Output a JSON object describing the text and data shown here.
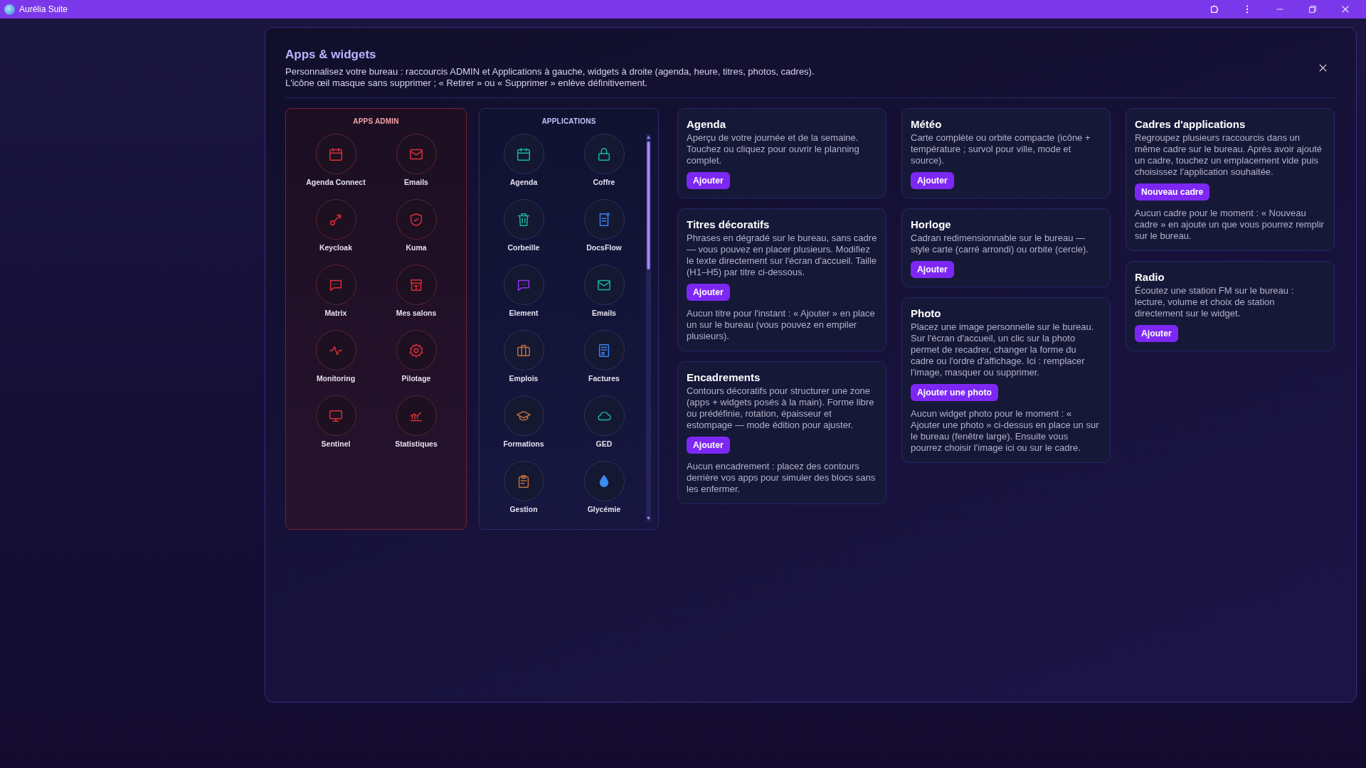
{
  "titlebar": {
    "title": "Aurélia Suite"
  },
  "dialog": {
    "title": "Apps & widgets",
    "description": [
      "Personnalisez votre bureau : raccourcis ADMIN et Applications à gauche, widgets à droite (agenda, heure, titres, photos, cadres).",
      "L'icône œil masque sans supprimer ; « Retirer » ou « Supprimer » enlève définitivement."
    ]
  },
  "admin_apps": {
    "heading": "APPS ADMIN",
    "items": [
      {
        "label": "Agenda Connect",
        "kind": "calendar"
      },
      {
        "label": "Emails",
        "kind": "mail"
      },
      {
        "label": "Keycloak",
        "kind": "key"
      },
      {
        "label": "Kuma",
        "kind": "shield"
      },
      {
        "label": "Matrix",
        "kind": "chat"
      },
      {
        "label": "Mes salons",
        "kind": "archive"
      },
      {
        "label": "Monitoring",
        "kind": "pulse"
      },
      {
        "label": "Pilotage",
        "kind": "gear"
      },
      {
        "label": "Sentinel",
        "kind": "monitor"
      },
      {
        "label": "Statistiques",
        "kind": "chart"
      }
    ]
  },
  "applications": {
    "heading": "APPLICATIONS",
    "items": [
      {
        "label": "Agenda",
        "kind": "calendar",
        "color": "#14b8a6"
      },
      {
        "label": "Coffre",
        "kind": "lock",
        "color": "#14b8a6"
      },
      {
        "label": "Corbeille",
        "kind": "trash",
        "color": "#14b8a6"
      },
      {
        "label": "DocsFlow",
        "kind": "document",
        "color": "#3b82f6"
      },
      {
        "label": "Element",
        "kind": "chat",
        "color": "#9333ea"
      },
      {
        "label": "Emails",
        "kind": "mail",
        "color": "#14b8a6"
      },
      {
        "label": "Emplois",
        "kind": "briefcase",
        "color": "#c2703d"
      },
      {
        "label": "Factures",
        "kind": "invoice",
        "color": "#3b82f6"
      },
      {
        "label": "Formations",
        "kind": "graduation-cap",
        "color": "#c2703d"
      },
      {
        "label": "GED",
        "kind": "cloud",
        "color": "#14b8a6"
      },
      {
        "label": "Gestion",
        "kind": "clipboard",
        "color": "#c2703d"
      },
      {
        "label": "Glycémie",
        "kind": "drop",
        "color": "#3b8bf0"
      }
    ]
  },
  "widget_columns": [
    [
      {
        "title": "Agenda",
        "description": "Aperçu de votre journée et de la semaine. Touchez ou cliquez pour ouvrir le planning complet.",
        "button": "Ajouter"
      },
      {
        "title": "Titres décoratifs",
        "description": "Phrases en dégradé sur le bureau, sans cadre — vous pouvez en placer plusieurs. Modifiez le texte directement sur l'écran d'accueil. Taille (H1–H5) par titre ci-dessous.",
        "button": "Ajouter",
        "note": "Aucun titre pour l'instant : « Ajouter » en place un sur le bureau (vous pouvez en empiler plusieurs)."
      },
      {
        "title": "Encadrements",
        "description": "Contours décoratifs pour structurer une zone (apps + widgets posés à la main). Forme libre ou prédéfinie, rotation, épaisseur et estompage — mode édition pour ajuster.",
        "button": "Ajouter",
        "note": "Aucun encadrement : placez des contours derrière vos apps pour simuler des blocs sans les enfermer."
      }
    ],
    [
      {
        "title": "Météo",
        "description": "Carte complète ou orbite compacte (icône + température ; survol pour ville, mode et source).",
        "button": "Ajouter"
      },
      {
        "title": "Horloge",
        "description": "Cadran redimensionnable sur le bureau — style carte (carré arrondi) ou orbite (cercle).",
        "button": "Ajouter"
      },
      {
        "title": "Photo",
        "description": "Placez une image personnelle sur le bureau. Sur l'écran d'accueil, un clic sur la photo permet de recadrer, changer la forme du cadre ou l'ordre d'affichage. Ici : remplacer l'image, masquer ou supprimer.",
        "button": "Ajouter une photo",
        "note": "Aucun widget photo pour le moment : « Ajouter une photo » ci-dessus en place un sur le bureau (fenêtre large). Ensuite vous pourrez choisir l'image ici ou sur le cadre."
      }
    ],
    [
      {
        "title": "Cadres d'applications",
        "description": "Regroupez plusieurs raccourcis dans un même cadre sur le bureau. Après avoir ajouté un cadre, touchez un emplacement vide puis choisissez l'application souhaitée.",
        "button": "Nouveau cadre",
        "note": "Aucun cadre pour le moment : « Nouveau cadre » en ajoute un que vous pourrez remplir sur le bureau."
      },
      {
        "title": "Radio",
        "description": "Écoutez une station FM sur le bureau : lecture, volume et choix de station directement sur le widget.",
        "button": "Ajouter"
      }
    ]
  ]
}
